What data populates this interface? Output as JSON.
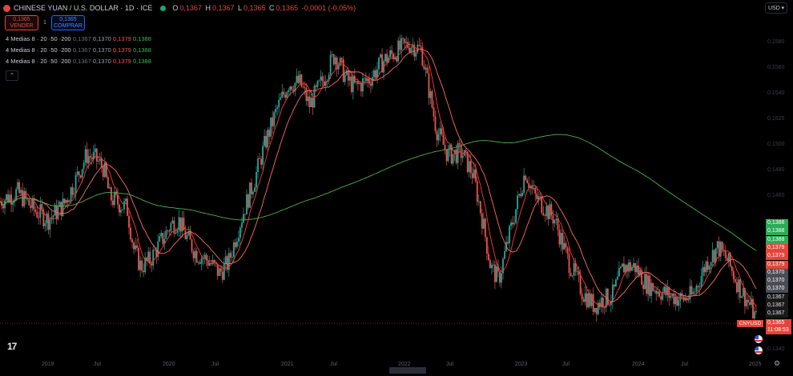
{
  "header": {
    "title": "CHINESE YUAN / U.S. DOLLAR · 1D · ICE",
    "ohlc": [
      {
        "k": "O",
        "v": "0,1367"
      },
      {
        "k": "H",
        "v": "0,1367"
      },
      {
        "k": "L",
        "v": "0,1365"
      },
      {
        "k": "C",
        "v": "0,1365"
      }
    ],
    "change": "-0,0001 (-0,05%)"
  },
  "trade": {
    "sell_price": "0,1365",
    "sell_label": "VENDER",
    "spread": "1",
    "buy_price": "0,1365",
    "buy_label": "COMPRAR"
  },
  "indicators": [
    {
      "name": "4 Medias 8 · 20 ·50 ·200",
      "values": [
        "0,1367",
        "0,1370",
        "0,1379",
        "0,1388"
      ]
    },
    {
      "name": "4 Medias 8 · 20 ·50 ·200",
      "values": [
        "0,1367",
        "0,1370",
        "0,1379",
        "0,1388"
      ]
    },
    {
      "name": "4 Medias 8 · 20 ·50 ·200",
      "values": [
        "0,1367",
        "0,1370",
        "0,1379",
        "0,1388"
      ]
    }
  ],
  "collapse_icon": "chevron-up-icon",
  "currency_select": "USD",
  "price_axis": [
    "0,1580",
    "0,1560",
    "0,1540",
    "0,1520",
    "0,1500",
    "0,1480",
    "0,1460",
    "0,1440",
    "0,1420",
    "0,1400",
    "0,1380",
    "0,1360",
    "0,1340"
  ],
  "price_labels": [
    {
      "text": "0,1388",
      "kind": "green"
    },
    {
      "text": "0,1388",
      "kind": "green"
    },
    {
      "text": "0,1388",
      "kind": "green"
    },
    {
      "text": "0,1379",
      "kind": "red"
    },
    {
      "text": "0,1379",
      "kind": "red"
    },
    {
      "text": "0,1379",
      "kind": "red"
    },
    {
      "text": "0,1370",
      "kind": "gray"
    },
    {
      "text": "0,1370",
      "kind": "gray"
    },
    {
      "text": "0,1370",
      "kind": "gray"
    },
    {
      "text": "0,1367",
      "kind": "dark"
    },
    {
      "text": "0,1367",
      "kind": "dark"
    },
    {
      "text": "0,1367",
      "kind": "dark"
    }
  ],
  "current": {
    "symbol": "CNYUSD",
    "price": "0,1365",
    "countdown": "11:08:53"
  },
  "x_axis": [
    "2019",
    "Jul",
    "2020",
    "Jul",
    "2021",
    "Jul",
    "2022",
    "Jul",
    "2023",
    "Jul",
    "2024",
    "Jul",
    "2025"
  ],
  "colors": {
    "bull": "#26a69a",
    "bear": "#ef5350",
    "ema8": "#ff3b30",
    "ema20": "#ff6b6b",
    "ema200": "#4caf50",
    "background": "#000000"
  },
  "chart_data": {
    "type": "candlestick",
    "ylim": [
      0.134,
      0.159
    ],
    "series": [
      {
        "name": "price",
        "kind": "close",
        "points": [
          [
            2018.5,
            0.1455
          ],
          [
            2018.65,
            0.1462
          ],
          [
            2018.8,
            0.1448
          ],
          [
            2018.92,
            0.1441
          ],
          [
            2019.05,
            0.1452
          ],
          [
            2019.15,
            0.147
          ],
          [
            2019.25,
            0.149
          ],
          [
            2019.33,
            0.1487
          ],
          [
            2019.4,
            0.148
          ],
          [
            2019.45,
            0.1458
          ],
          [
            2019.55,
            0.1452
          ],
          [
            2019.6,
            0.145
          ],
          [
            2019.66,
            0.1418
          ],
          [
            2019.72,
            0.1405
          ],
          [
            2019.8,
            0.141
          ],
          [
            2019.9,
            0.1425
          ],
          [
            2019.98,
            0.1437
          ],
          [
            2020.05,
            0.144
          ],
          [
            2020.1,
            0.143
          ],
          [
            2020.2,
            0.1415
          ],
          [
            2020.3,
            0.141
          ],
          [
            2020.4,
            0.14
          ],
          [
            2020.48,
            0.1408
          ],
          [
            2020.55,
            0.143
          ],
          [
            2020.62,
            0.145
          ],
          [
            2020.7,
            0.147
          ],
          [
            2020.8,
            0.15
          ],
          [
            2020.9,
            0.1525
          ],
          [
            2021.0,
            0.1545
          ],
          [
            2021.1,
            0.1545
          ],
          [
            2021.18,
            0.1528
          ],
          [
            2021.3,
            0.1548
          ],
          [
            2021.4,
            0.1567
          ],
          [
            2021.5,
            0.1548
          ],
          [
            2021.58,
            0.1542
          ],
          [
            2021.7,
            0.1548
          ],
          [
            2021.82,
            0.1562
          ],
          [
            2021.95,
            0.157
          ],
          [
            2022.05,
            0.1575
          ],
          [
            2022.15,
            0.157
          ],
          [
            2022.28,
            0.151
          ],
          [
            2022.38,
            0.149
          ],
          [
            2022.5,
            0.1492
          ],
          [
            2022.6,
            0.1475
          ],
          [
            2022.68,
            0.144
          ],
          [
            2022.75,
            0.1405
          ],
          [
            2022.82,
            0.1395
          ],
          [
            2022.9,
            0.1425
          ],
          [
            2023.0,
            0.146
          ],
          [
            2023.05,
            0.1478
          ],
          [
            2023.12,
            0.146
          ],
          [
            2023.2,
            0.1452
          ],
          [
            2023.3,
            0.1442
          ],
          [
            2023.42,
            0.141
          ],
          [
            2023.55,
            0.1385
          ],
          [
            2023.65,
            0.1375
          ],
          [
            2023.72,
            0.138
          ],
          [
            2023.8,
            0.1382
          ],
          [
            2023.9,
            0.1405
          ],
          [
            2024.0,
            0.1405
          ],
          [
            2024.1,
            0.1392
          ],
          [
            2024.25,
            0.1385
          ],
          [
            2024.4,
            0.138
          ],
          [
            2024.5,
            0.1383
          ],
          [
            2024.62,
            0.1408
          ],
          [
            2024.72,
            0.142
          ],
          [
            2024.8,
            0.141
          ],
          [
            2024.9,
            0.139
          ],
          [
            2025.0,
            0.1375
          ],
          [
            2025.05,
            0.1365
          ]
        ]
      },
      {
        "name": "8",
        "color": "#ff3b30"
      },
      {
        "name": "20",
        "color": "#ff6b6b"
      },
      {
        "name": "200",
        "color": "#4caf50"
      }
    ],
    "legend": "top-left",
    "grid": false
  }
}
